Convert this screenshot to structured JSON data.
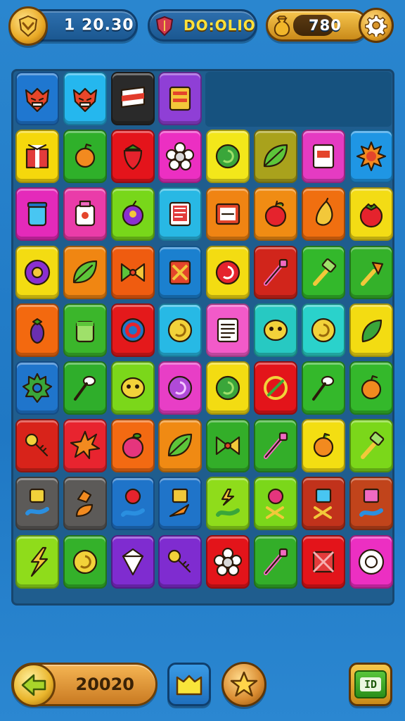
{
  "hud": {
    "left_counter": {
      "value": "1 20.30",
      "icon": "shield-coin-icon"
    },
    "title_banner": {
      "text": "DO:OLIO",
      "icon": "shield-icon"
    },
    "coins": {
      "value": "780",
      "icon": "coin-bag-icon"
    },
    "settings": {
      "icon": "gear-icon"
    }
  },
  "board": {
    "rows": [
      [
        {
          "color": "#1f77d0",
          "icon": "demon-face-icon"
        },
        {
          "color": "#25b7ee",
          "icon": "demon-face-icon"
        },
        {
          "color": "#2a2a2a",
          "icon": "flag-stripe-icon"
        },
        {
          "color": "#8f3fd6",
          "icon": "book-icon"
        }
      ],
      [
        {
          "color": "#f5d80c",
          "icon": "gift-box-icon"
        },
        {
          "color": "#2fb02a",
          "icon": "orange-fruit-icon"
        },
        {
          "color": "#e4141b",
          "icon": "strawberry-icon"
        },
        {
          "color": "#ec2fc2",
          "icon": "flower-icon"
        },
        {
          "color": "#f3e71a",
          "icon": "green-swirl-icon"
        },
        {
          "color": "#a9a21c",
          "icon": "leaf-icon"
        },
        {
          "color": "#e53bc2",
          "icon": "card-icon"
        },
        {
          "color": "#1f96e4",
          "icon": "sun-icon"
        }
      ],
      [
        {
          "color": "#e42aba",
          "icon": "jar-icon"
        },
        {
          "color": "#ea3ca9",
          "icon": "potion-icon"
        },
        {
          "color": "#78d71a",
          "icon": "plum-icon"
        },
        {
          "color": "#28b8e4",
          "icon": "clipboard-icon"
        },
        {
          "color": "#f08413",
          "icon": "scroll-icon"
        },
        {
          "color": "#f08c13",
          "icon": "apple-icon"
        },
        {
          "color": "#f06f10",
          "icon": "pear-icon"
        },
        {
          "color": "#f3dc15",
          "icon": "tomato-icon"
        }
      ],
      [
        {
          "color": "#f3dc12",
          "icon": "purple-gear-icon"
        },
        {
          "color": "#f08612",
          "icon": "leaf-icon"
        },
        {
          "color": "#ef5c10",
          "icon": "bow-icon"
        },
        {
          "color": "#1b80cf",
          "icon": "crossed-box-icon"
        },
        {
          "color": "#f3dc12",
          "icon": "red-swirl-icon"
        },
        {
          "color": "#d1251b",
          "icon": "wand-icon"
        },
        {
          "color": "#33b82b",
          "icon": "hammer-icon"
        },
        {
          "color": "#34b12a",
          "icon": "torch-icon"
        }
      ],
      [
        {
          "color": "#f3690f",
          "icon": "eggplant-icon"
        },
        {
          "color": "#3bb62b",
          "icon": "cup-icon"
        },
        {
          "color": "#e4191b",
          "icon": "ring-target-icon"
        },
        {
          "color": "#27b9e5",
          "icon": "yellow-swirl-icon"
        },
        {
          "color": "#f25ac9",
          "icon": "note-icon"
        },
        {
          "color": "#27c9c2",
          "icon": "lemon-face-icon"
        },
        {
          "color": "#2ad2cb",
          "icon": "yellow-swirl-icon"
        },
        {
          "color": "#f3dc12",
          "icon": "green-leaf-icon"
        }
      ],
      [
        {
          "color": "#1f75cc",
          "icon": "green-gear-icon"
        },
        {
          "color": "#2fae2b",
          "icon": "spoon-icon"
        },
        {
          "color": "#7bd71a",
          "icon": "lemon-face-icon"
        },
        {
          "color": "#e83ec6",
          "icon": "purple-swirl-icon"
        },
        {
          "color": "#f3dc12",
          "icon": "green-swirl-icon"
        },
        {
          "color": "#e3141a",
          "icon": "strike-circle-icon"
        },
        {
          "color": "#34b82b",
          "icon": "spoon-icon"
        },
        {
          "color": "#34b82b",
          "icon": "orange-fruit-icon"
        }
      ],
      [
        {
          "color": "#d8231a",
          "icon": "key-icon"
        },
        {
          "color": "#e8242f",
          "icon": "starburst-icon"
        },
        {
          "color": "#f36a12",
          "icon": "berry-icon"
        },
        {
          "color": "#f08a13",
          "icon": "leaf-icon"
        },
        {
          "color": "#33ae29",
          "icon": "bow-icon"
        },
        {
          "color": "#33ae29",
          "icon": "wand-icon"
        },
        {
          "color": "#f3de12",
          "icon": "orange-fruit-icon"
        },
        {
          "color": "#7bd71a",
          "icon": "hammer-icon"
        }
      ],
      [
        {
          "color": "#5c5a58",
          "icon": "cup-and-worm-icon"
        },
        {
          "color": "#5c5a58",
          "icon": "shard-and-leaf-icon"
        },
        {
          "color": "#1f74c9",
          "icon": "apple-and-worm-icon"
        },
        {
          "color": "#1f74c9",
          "icon": "box-and-dart-icon"
        },
        {
          "color": "#8fdc1b",
          "icon": "bolt-and-worm-icon"
        },
        {
          "color": "#7bd71a",
          "icon": "apple-and-cross-icon"
        },
        {
          "color": "#c1321b",
          "icon": "cube-and-cross-icon"
        },
        {
          "color": "#c1441b",
          "icon": "cube-and-worm-icon"
        }
      ],
      [
        {
          "color": "#8fdc1b",
          "icon": "bolt-icon"
        },
        {
          "color": "#34b12a",
          "icon": "yellow-swirl-icon"
        },
        {
          "color": "#7f2cd0",
          "icon": "gem-icon"
        },
        {
          "color": "#7f2cd0",
          "icon": "key-icon"
        },
        {
          "color": "#e3141a",
          "icon": "flower-icon"
        },
        {
          "color": "#33ae29",
          "icon": "wand-icon"
        },
        {
          "color": "#e3141a",
          "icon": "crate-icon"
        },
        {
          "color": "#ec2fc2",
          "icon": "white-ring-icon"
        }
      ]
    ]
  },
  "bottom": {
    "back": {
      "icon": "back-arrow-icon"
    },
    "score": "20020",
    "map": {
      "icon": "map-icon"
    },
    "star": {
      "icon": "star-icon"
    },
    "menu": {
      "icon": "id-card-icon",
      "label": "ID"
    }
  }
}
